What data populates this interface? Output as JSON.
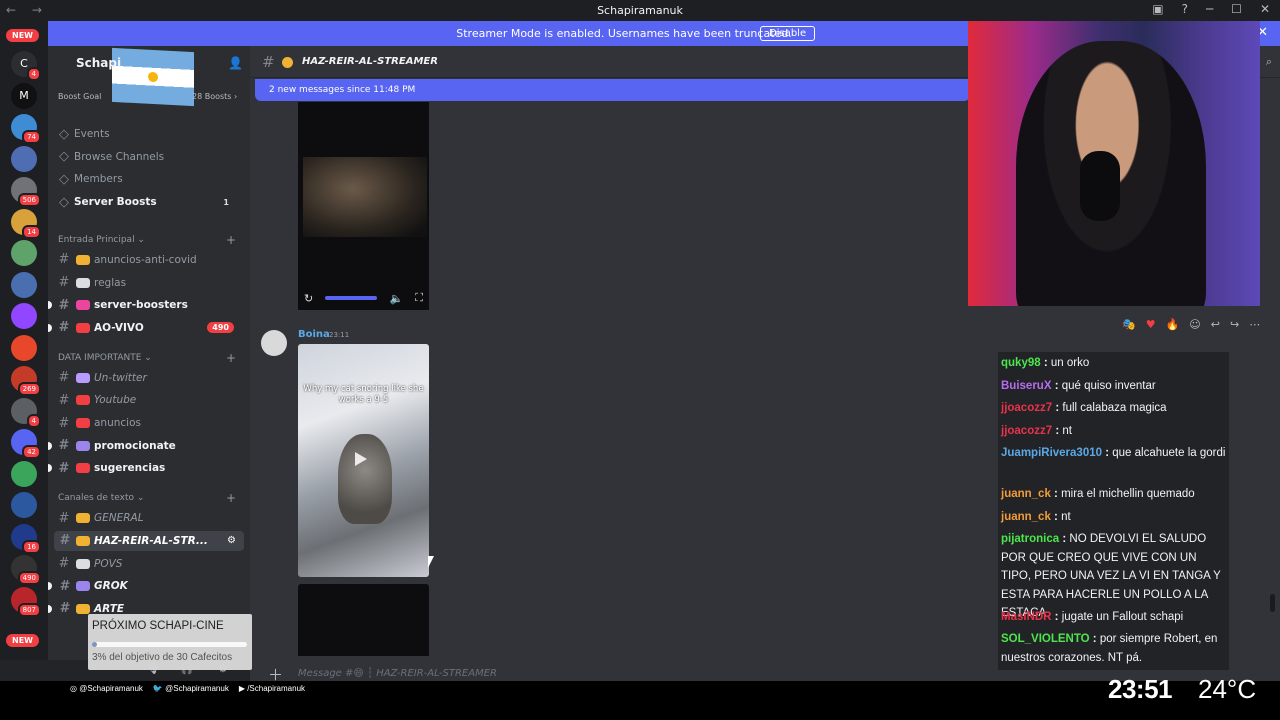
{
  "window": {
    "title": "Schapiramanuk",
    "nav": "← →"
  },
  "banner": {
    "text": "Streamer Mode is enabled. Usernames have been truncated.",
    "disable_label": "Disable",
    "close": "✕"
  },
  "servers": {
    "new_label_top": "NEW",
    "new_label_bottom": "NEW",
    "items": [
      {
        "label": "C",
        "badge": "4",
        "color": "#2b2d31"
      },
      {
        "label": "M",
        "badge": "",
        "color": "#111111"
      },
      {
        "label": "",
        "badge": "74",
        "color": "#3d8cd4"
      },
      {
        "label": "",
        "badge": "",
        "color": "#4f6db3"
      },
      {
        "label": "",
        "badge": "506",
        "color": "#6f7378"
      },
      {
        "label": "",
        "badge": "14",
        "color": "#d9a13b"
      },
      {
        "label": "",
        "badge": "",
        "color": "#5fa36a"
      },
      {
        "label": "",
        "badge": "",
        "color": "#4a6fb0"
      },
      {
        "label": "",
        "badge": "",
        "color": "#9146ff"
      },
      {
        "label": "",
        "badge": "",
        "color": "#e8472c"
      },
      {
        "label": "",
        "badge": "269",
        "color": "#c43b2a"
      },
      {
        "label": "",
        "badge": "4",
        "color": "#5c5f64"
      },
      {
        "label": "",
        "badge": "42",
        "color": "#5865f2"
      },
      {
        "label": "",
        "badge": "",
        "color": "#3ba55c"
      },
      {
        "label": "",
        "badge": "",
        "color": "#2c58a0"
      },
      {
        "label": "",
        "badge": "16",
        "color": "#203b8c"
      },
      {
        "label": "",
        "badge": "490",
        "color": "#333333"
      },
      {
        "label": "",
        "badge": "807",
        "color": "#b8252a"
      }
    ]
  },
  "guild": {
    "name": "Schapi",
    "boost_goal": "Boost Goal",
    "boosts": "28 Boosts ›"
  },
  "sidebar": {
    "top_items": [
      {
        "icon": "calendar-icon",
        "label": "Events"
      },
      {
        "icon": "browse-icon",
        "label": "Browse Channels"
      },
      {
        "icon": "members-icon",
        "label": "Members"
      },
      {
        "icon": "boost-icon",
        "label": "Server Boosts",
        "count": "1"
      }
    ],
    "categories": [
      {
        "label": "Entrada Principal ⌄",
        "channels": [
          {
            "label": "anuncios-anti-covid",
            "emo": "#f0b232",
            "style": "normal"
          },
          {
            "label": "reglas",
            "emo": "#dbdee1",
            "style": "normal"
          },
          {
            "label": "server-boosters",
            "emo": "#eb459e",
            "style": "bold"
          },
          {
            "label": "AO-VIVO",
            "emo": "#f23f43",
            "style": "bold",
            "count": "490"
          }
        ]
      },
      {
        "label": "DATA IMPORTANTE ⌄",
        "channels": [
          {
            "label": "Un-twitter",
            "emo": "#b89bff",
            "style": "italic"
          },
          {
            "label": "Youtube",
            "emo": "#f23f43",
            "style": "italic"
          },
          {
            "label": "anuncios",
            "emo": "#f23f43",
            "style": "normal"
          },
          {
            "label": "promocionate",
            "emo": "#9b84ec",
            "style": "bold"
          },
          {
            "label": "sugerencias",
            "emo": "#f23f43",
            "style": "bold"
          }
        ]
      },
      {
        "label": "Canales de texto ⌄",
        "channels": [
          {
            "label": "GENERAL",
            "emo": "#f0b232",
            "style": "italic"
          },
          {
            "label": "HAZ-REIR-AL-STR...",
            "emo": "#f0b232",
            "style": "selected"
          },
          {
            "label": "POVS",
            "emo": "#dbdee1",
            "style": "italic"
          },
          {
            "label": "GROK",
            "emo": "#9b84ec",
            "style": "bolditalic"
          },
          {
            "label": "ARTE",
            "emo": "#f0b232",
            "style": "bolditalic"
          }
        ]
      }
    ]
  },
  "channel": {
    "name": "HAZ-REIR-AL-STREAMER",
    "new_messages": "2 new messages since 11:48 PM",
    "placeholder": "Message #😄 ┆ HAZ-REIR-AL-STREAMER"
  },
  "message": {
    "author": "Boina",
    "time": "23:11",
    "video_caption": "Why my cat snoring like she works a 9-5"
  },
  "chat": [
    {
      "user": "quky98",
      "text": "un orko",
      "color": "#4ce64c"
    },
    {
      "user": "BuiseruX",
      "text": "qué quiso inventar",
      "color": "#b86cf0"
    },
    {
      "user": "jjoacozz7",
      "text": "full calabaza magica",
      "color": "#e8334a"
    },
    {
      "user": "jjoacozz7",
      "text": "nt",
      "color": "#e8334a"
    },
    {
      "user": "JuampiRivera3010",
      "text": "que alcahuete la gordi",
      "color": "#5aa9e6"
    },
    {
      "user": "juann_ck",
      "text": "mira el michellin quemado",
      "color": "#f29c38"
    },
    {
      "user": "juann_ck",
      "text": "nt",
      "color": "#f29c38"
    },
    {
      "user": "pijatronica",
      "text": "NO DEVOLVI EL SALUDO POR QUE CREO QUE VIVE CON UN TIPO, PERO UNA VEZ LA VI EN TANGA Y ESTA PARA HACERLE UN POLLO A LA ESTACA",
      "color": "#4ce64c"
    },
    {
      "user": "MasiNDR",
      "text": "jugate un Fallout schapi",
      "color": "#e8334a"
    },
    {
      "user": "SOL_VIOLENTO",
      "text": "por siempre Robert, en nuestros corazones. NT pá.",
      "color": "#4ce64c"
    }
  ],
  "overlay": {
    "cine_title": "PRÓXIMO SCHAPI-CINE",
    "cine_status": "3% del objetivo de 30 Cafecitos",
    "cine_progress": 0.03,
    "socials": [
      "@Schapiramanuk",
      "@Schapiramanuk",
      "/Schapiramanuk"
    ],
    "clock": "23:51",
    "temp": "24°C",
    "logo": "Schapi"
  }
}
